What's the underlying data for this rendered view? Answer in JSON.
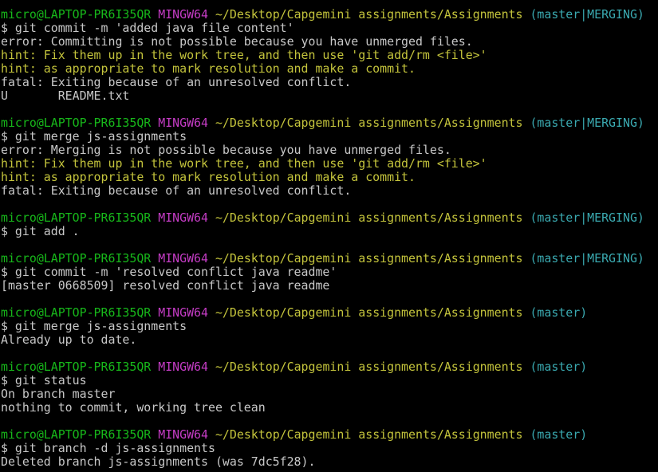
{
  "colors": {
    "user": "#17b81a",
    "system": "#c43cc4",
    "path": "#c4c43c",
    "branch": "#3aa9b0",
    "hint": "#c4c43c",
    "text": "#c8c8c8",
    "background": "#000000"
  },
  "lines": [
    [
      {
        "t": "micro@LAPTOP-PR6I35QR",
        "c": "user"
      },
      {
        "t": " "
      },
      {
        "t": "MINGW64",
        "c": "sys"
      },
      {
        "t": " "
      },
      {
        "t": "~/Desktop/Capgemini assignments/Assignments",
        "c": "path"
      },
      {
        "t": " "
      },
      {
        "t": "(master|MERGING)",
        "c": "branch"
      }
    ],
    [
      {
        "t": "$ git commit -m 'added java file content'"
      }
    ],
    [
      {
        "t": "error: Committing is not possible because you have unmerged files."
      }
    ],
    [
      {
        "t": "hint: Fix them up in the work tree, and then use 'git add/rm <file>'",
        "c": "hint"
      }
    ],
    [
      {
        "t": "hint: as appropriate to mark resolution and make a commit.",
        "c": "hint"
      }
    ],
    [
      {
        "t": "fatal: Exiting because of an unresolved conflict."
      }
    ],
    [
      {
        "t": "U       README.txt"
      }
    ],
    [],
    [
      {
        "t": "micro@LAPTOP-PR6I35QR",
        "c": "user"
      },
      {
        "t": " "
      },
      {
        "t": "MINGW64",
        "c": "sys"
      },
      {
        "t": " "
      },
      {
        "t": "~/Desktop/Capgemini assignments/Assignments",
        "c": "path"
      },
      {
        "t": " "
      },
      {
        "t": "(master|MERGING)",
        "c": "branch"
      }
    ],
    [
      {
        "t": "$ git merge js-assignments"
      }
    ],
    [
      {
        "t": "error: Merging is not possible because you have unmerged files."
      }
    ],
    [
      {
        "t": "hint: Fix them up in the work tree, and then use 'git add/rm <file>'",
        "c": "hint"
      }
    ],
    [
      {
        "t": "hint: as appropriate to mark resolution and make a commit.",
        "c": "hint"
      }
    ],
    [
      {
        "t": "fatal: Exiting because of an unresolved conflict."
      }
    ],
    [],
    [
      {
        "t": "micro@LAPTOP-PR6I35QR",
        "c": "user"
      },
      {
        "t": " "
      },
      {
        "t": "MINGW64",
        "c": "sys"
      },
      {
        "t": " "
      },
      {
        "t": "~/Desktop/Capgemini assignments/Assignments",
        "c": "path"
      },
      {
        "t": " "
      },
      {
        "t": "(master|MERGING)",
        "c": "branch"
      }
    ],
    [
      {
        "t": "$ git add ."
      }
    ],
    [],
    [
      {
        "t": "micro@LAPTOP-PR6I35QR",
        "c": "user"
      },
      {
        "t": " "
      },
      {
        "t": "MINGW64",
        "c": "sys"
      },
      {
        "t": " "
      },
      {
        "t": "~/Desktop/Capgemini assignments/Assignments",
        "c": "path"
      },
      {
        "t": " "
      },
      {
        "t": "(master|MERGING)",
        "c": "branch"
      }
    ],
    [
      {
        "t": "$ git commit -m 'resolved conflict java readme'"
      }
    ],
    [
      {
        "t": "[master 0668509] resolved conflict java readme"
      }
    ],
    [],
    [
      {
        "t": "micro@LAPTOP-PR6I35QR",
        "c": "user"
      },
      {
        "t": " "
      },
      {
        "t": "MINGW64",
        "c": "sys"
      },
      {
        "t": " "
      },
      {
        "t": "~/Desktop/Capgemini assignments/Assignments",
        "c": "path"
      },
      {
        "t": " "
      },
      {
        "t": "(master)",
        "c": "branch"
      }
    ],
    [
      {
        "t": "$ git merge js-assignments"
      }
    ],
    [
      {
        "t": "Already up to date."
      }
    ],
    [],
    [
      {
        "t": "micro@LAPTOP-PR6I35QR",
        "c": "user"
      },
      {
        "t": " "
      },
      {
        "t": "MINGW64",
        "c": "sys"
      },
      {
        "t": " "
      },
      {
        "t": "~/Desktop/Capgemini assignments/Assignments",
        "c": "path"
      },
      {
        "t": " "
      },
      {
        "t": "(master)",
        "c": "branch"
      }
    ],
    [
      {
        "t": "$ git status"
      }
    ],
    [
      {
        "t": "On branch master"
      }
    ],
    [
      {
        "t": "nothing to commit, working tree clean"
      }
    ],
    [],
    [
      {
        "t": "micro@LAPTOP-PR6I35QR",
        "c": "user"
      },
      {
        "t": " "
      },
      {
        "t": "MINGW64",
        "c": "sys"
      },
      {
        "t": " "
      },
      {
        "t": "~/Desktop/Capgemini assignments/Assignments",
        "c": "path"
      },
      {
        "t": " "
      },
      {
        "t": "(master)",
        "c": "branch"
      }
    ],
    [
      {
        "t": "$ git branch -d js-assignments"
      }
    ],
    [
      {
        "t": "Deleted branch js-assignments (was 7dc5f28)."
      }
    ]
  ]
}
